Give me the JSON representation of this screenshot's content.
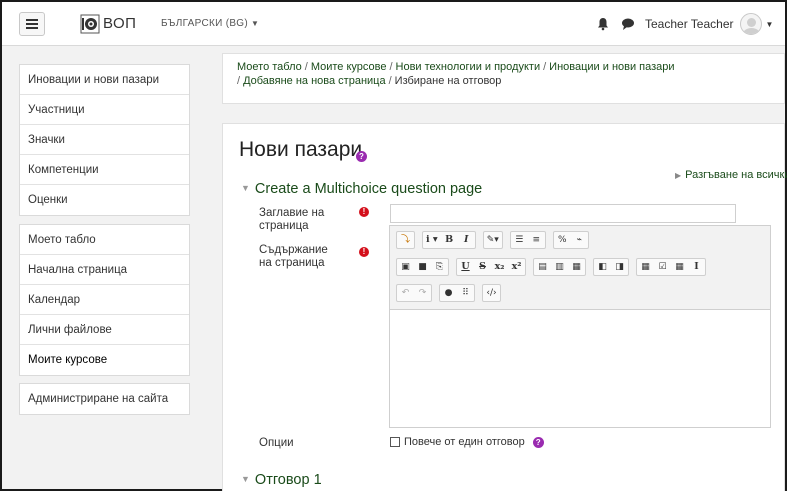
{
  "navbar": {
    "site_name": "ВОП",
    "language": "БЪЛГАРСКИ (BG)",
    "user_name": "Teacher Teacher"
  },
  "sidebar": {
    "course_block": [
      "Иновации и нови пазари",
      "Участници",
      "Значки",
      "Компетенции",
      "Оценки"
    ],
    "nav_block": [
      "Моето табло",
      "Начална страница",
      "Календар",
      "Лични файлове",
      "Моите курсове"
    ],
    "admin_block": [
      "Администриране на сайта"
    ]
  },
  "breadcrumb": {
    "line1": [
      "Моето табло",
      "Моите курсове",
      "Нови технологии и продукти",
      "Иновации и нови пазари"
    ],
    "line2_links": [
      "Добавяне на нова страница"
    ],
    "current": "Избиране на отговор"
  },
  "main": {
    "title": "Нови пазари",
    "expand_all": "Разгъване на всички",
    "section_heading": "Create a Multichoice question page",
    "title_label": "Заглавие на страница",
    "content_label": "Съдържание на страница",
    "options_label": "Опции",
    "checkbox_label": "Повече от един отговор",
    "checkbox_checked": false,
    "answer_heading": "Отговор 1"
  },
  "editor_toolbar": {
    "row1": [
      [
        "i-info-icon"
      ],
      [
        "font-size-icon",
        "bold-icon",
        "italic-icon"
      ],
      [
        "text-color-icon"
      ],
      [
        "unordered-list-icon",
        "ordered-list-icon"
      ],
      [
        "link-icon",
        "unlink-icon"
      ]
    ],
    "row2": [
      [
        "image-icon",
        "media-icon",
        "manage-files-icon"
      ],
      [
        "underline-icon",
        "strikethrough-icon",
        "subscript-icon",
        "superscript-icon"
      ],
      [
        "align-left-icon",
        "align-center-icon",
        "align-right-icon"
      ],
      [
        "indent-decrease-icon",
        "indent-increase-icon"
      ],
      [
        "equation-icon",
        "special-char-icon",
        "table-icon",
        "clear-format-icon"
      ]
    ],
    "row3": [
      [
        "undo-icon",
        "redo-icon"
      ],
      [
        "accessibility-checker-icon",
        "screenreader-helper-icon"
      ],
      [
        "html-icon"
      ]
    ]
  },
  "colors": {
    "link": "#1a4b1a",
    "required": "#d4101c",
    "help": "#9a2bb0",
    "page_bg": "#f2f2f2"
  }
}
